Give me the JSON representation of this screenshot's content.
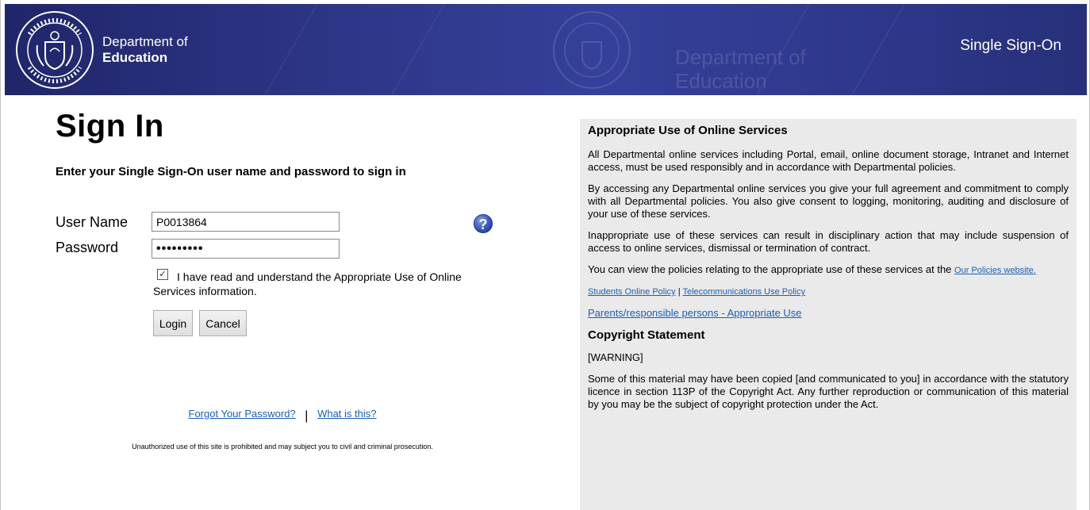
{
  "header": {
    "dept_line1": "Department of",
    "dept_line2": "Education",
    "watermark_line1": "Department of",
    "watermark_line2": "Education",
    "sso_label": "Single Sign-On",
    "colors": {
      "header_dark": "#21266a",
      "header_light": "#34419a"
    }
  },
  "login": {
    "title": "Sign In",
    "instruction": "Enter your Single Sign-On user name and password to sign in",
    "username_label": "User Name",
    "username_value": "P0013864",
    "password_label": "Password",
    "password_value": "•••••••••",
    "help_icon": "question-mark-icon",
    "agreement_checked": true,
    "agreement_text": "I have read and understand the Appropriate Use of Online Services information.",
    "login_button": "Login",
    "cancel_button": "Cancel"
  },
  "footer": {
    "forgot_link": "Forgot Your Password?",
    "separator": "|",
    "what_link": "What is this?",
    "disclaimer": "Unauthorized use of this site is prohibited and may subject you to civil and criminal prosecution."
  },
  "panel": {
    "heading": "Appropriate Use of Online Services",
    "p1": "All Departmental online services including Portal, email, online document storage, Intranet and Internet access, must be used responsibly and in accordance with Departmental policies.",
    "p2": "By accessing any Departmental online services you give your full agreement and commitment to comply with all Departmental policies. You also give consent to logging, monitoring, auditing and disclosure of your use of these services.",
    "p3": "Inappropriate use of these services can result in disciplinary action that may include suspension of access to online services, dismissal or termination of contract.",
    "p4_text": "You can view the policies relating to the appropriate use of these services at the",
    "p4_link": "Our Policies website.",
    "students_link": "Students Online Policy",
    "link_sep": "|",
    "telecom_link": "Telecommunications Use Policy",
    "parents_link": "Parents/responsible persons - Appropriate Use",
    "copyright_heading": "Copyright Statement",
    "warning": "[WARNING]",
    "copyright_text": "Some of this material may have been copied [and communicated to you] in accordance with the statutory licence in section 113P of the Copyright Act. Any further reproduction or communication of this material by you may be the subject of copyright protection under the Act."
  }
}
